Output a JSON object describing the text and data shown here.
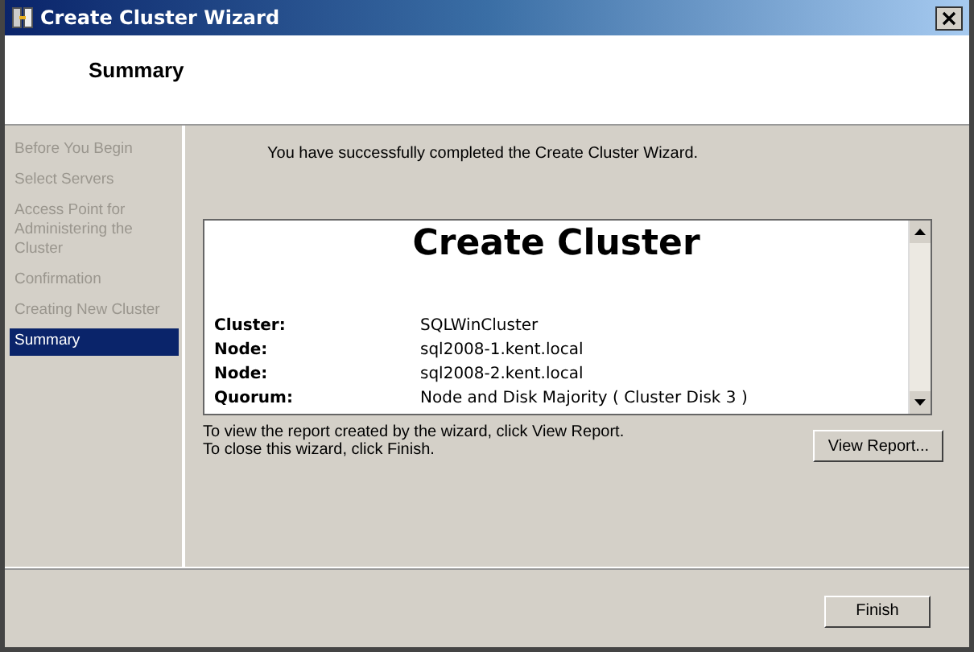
{
  "window": {
    "title": "Create Cluster Wizard"
  },
  "header": {
    "title": "Summary"
  },
  "steps": [
    {
      "label": "Before You Begin",
      "selected": false
    },
    {
      "label": "Select Servers",
      "selected": false
    },
    {
      "label": "Access Point for Administering the Cluster",
      "selected": false
    },
    {
      "label": "Confirmation",
      "selected": false
    },
    {
      "label": "Creating New Cluster",
      "selected": false
    },
    {
      "label": "Summary",
      "selected": true
    }
  ],
  "message": "You have successfully completed the Create Cluster Wizard.",
  "report": {
    "title": "Create Cluster",
    "rows": [
      {
        "label": "Cluster:",
        "value": "SQLWinCluster"
      },
      {
        "label": "Node:",
        "value": "sql2008-1.kent.local"
      },
      {
        "label": "Node:",
        "value": "sql2008-2.kent.local"
      },
      {
        "label": "Quorum:",
        "value": "Node and Disk Majority ( Cluster Disk 3 )"
      }
    ]
  },
  "instructions": [
    "To view the report created by the wizard, click View Report.",
    "To close this wizard, click Finish."
  ],
  "buttons": {
    "view_report": "View Report...",
    "finish": "Finish"
  }
}
